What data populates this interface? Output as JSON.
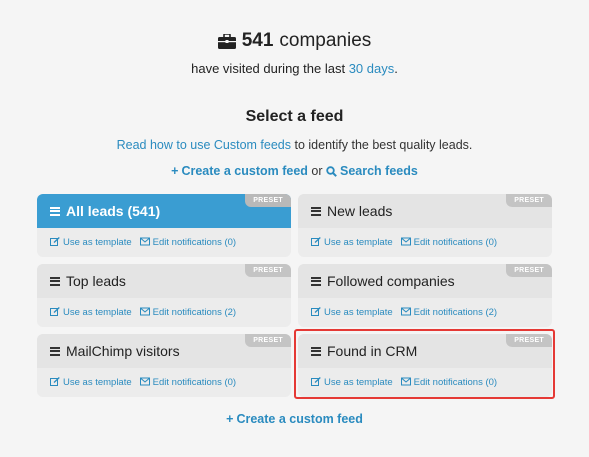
{
  "header": {
    "count": "541",
    "count_suffix": "companies",
    "visited_prefix": "have visited during the last",
    "visited_period": "30 days",
    "visited_suffix": "."
  },
  "select_title": "Select a feed",
  "read_how": {
    "link": "Read how to use Custom feeds",
    "suffix": "to identify the best quality leads."
  },
  "actions": {
    "create_label": "Create a custom feed",
    "or": "or",
    "search_label": "Search feeds"
  },
  "feeds": [
    {
      "title": "All leads (541)",
      "preset": "PRESET",
      "template": "Use as template",
      "notifications": "Edit notifications (0)"
    },
    {
      "title": "New leads",
      "preset": "PRESET",
      "template": "Use as template",
      "notifications": "Edit notifications (0)"
    },
    {
      "title": "Top leads",
      "preset": "PRESET",
      "template": "Use as template",
      "notifications": "Edit notifications (2)"
    },
    {
      "title": "Followed companies",
      "preset": "PRESET",
      "template": "Use as template",
      "notifications": "Edit notifications (2)"
    },
    {
      "title": "MailChimp visitors",
      "preset": "PRESET",
      "template": "Use as template",
      "notifications": "Edit notifications (0)"
    },
    {
      "title": "Found in CRM",
      "preset": "PRESET",
      "template": "Use as template",
      "notifications": "Edit notifications (0)"
    }
  ],
  "bottom_create": "Create a custom feed",
  "colors": {
    "accent": "#2a8bbf",
    "active_card": "#3a9dd2",
    "highlight": "#e53935"
  }
}
